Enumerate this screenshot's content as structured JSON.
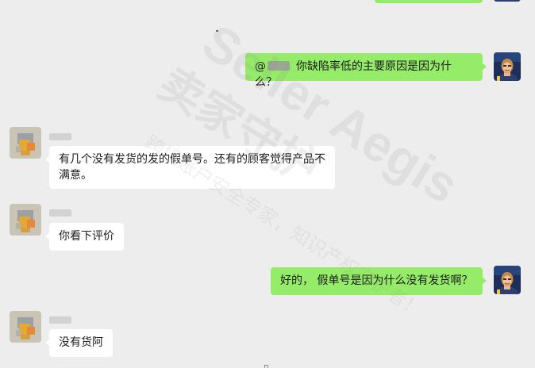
{
  "watermark": {
    "line1": "Seller Aegis",
    "line2": "卖家守护",
    "line3": "跨境账户安全专家，知识产权守护者！"
  },
  "messages": [
    {
      "side": "me",
      "prefix": "@",
      "text": "你缺陷率低的主要原因是因为什么？"
    },
    {
      "side": "other",
      "text": "有几个没有发货的发的假单号。还有的顾客觉得产品不满意。"
    },
    {
      "side": "other",
      "text": "你看下评价"
    },
    {
      "side": "me",
      "text": "好的， 假单号是因为什么没有发货啊？"
    },
    {
      "side": "other",
      "text": "没有货阿"
    }
  ],
  "colors": {
    "background": "#ededed",
    "my_bubble": "#95ec69",
    "their_bubble": "#ffffff"
  },
  "icons": {
    "my_avatar": "person-photo-avatar",
    "their_avatar": "blurred-avatar"
  }
}
